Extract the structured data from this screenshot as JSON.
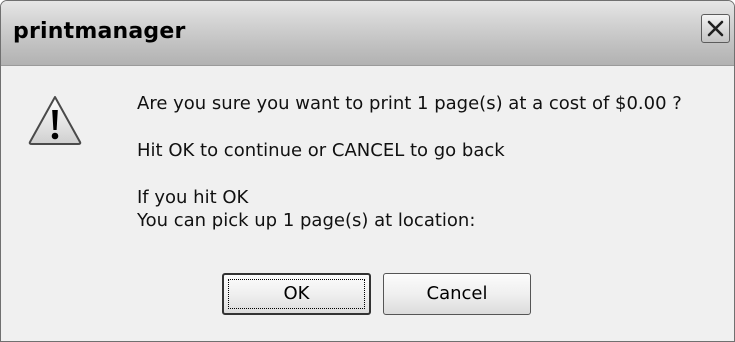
{
  "window": {
    "title": "printmanager"
  },
  "message": {
    "line1": "Are you sure you want to print 1 page(s) at a cost of $0.00 ?",
    "line2": "Hit OK to continue or CANCEL to go back",
    "line3": "If you hit OK",
    "line4": "You can pick up 1 page(s) at location:"
  },
  "buttons": {
    "ok_label": "OK",
    "cancel_label": "Cancel"
  },
  "icons": {
    "close": "close-icon",
    "warning": "warning-icon"
  }
}
